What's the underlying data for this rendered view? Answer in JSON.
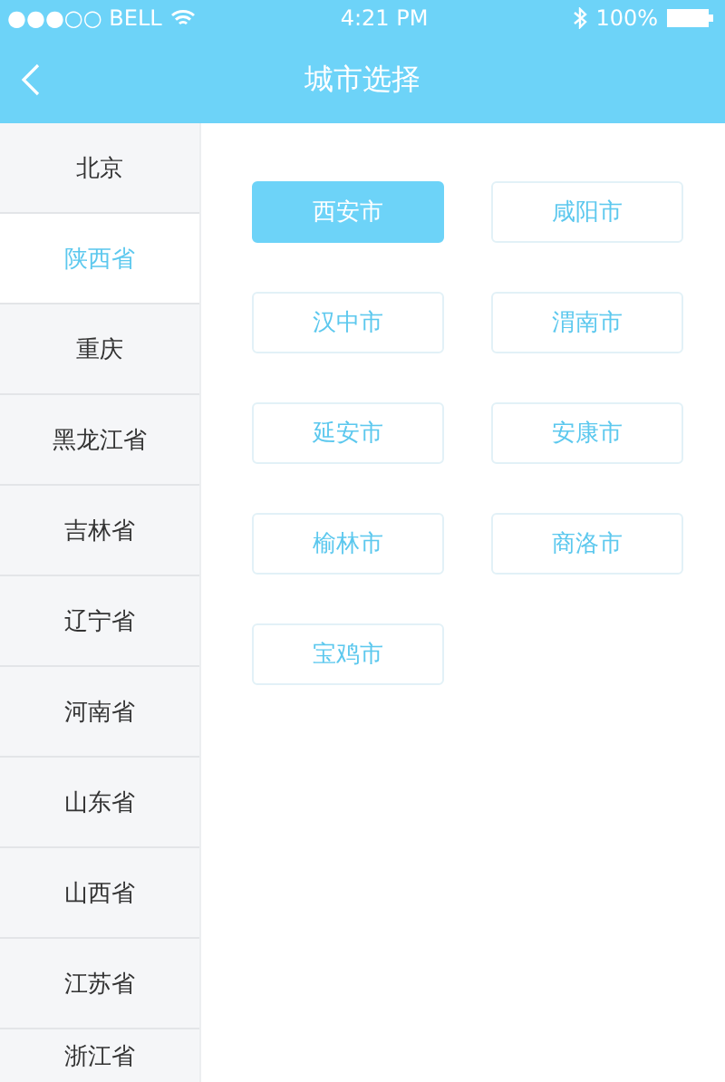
{
  "status_bar": {
    "carrier": "●●●○○ BELL",
    "time": "4:21 PM",
    "battery": "100%"
  },
  "nav_bar": {
    "title": "城市选择"
  },
  "provinces": [
    {
      "label": "北京",
      "selected": false
    },
    {
      "label": "陕西省",
      "selected": true
    },
    {
      "label": "重庆",
      "selected": false
    },
    {
      "label": "黑龙江省",
      "selected": false
    },
    {
      "label": "吉林省",
      "selected": false
    },
    {
      "label": "辽宁省",
      "selected": false
    },
    {
      "label": "河南省",
      "selected": false
    },
    {
      "label": "山东省",
      "selected": false
    },
    {
      "label": "山西省",
      "selected": false
    },
    {
      "label": "江苏省",
      "selected": false
    },
    {
      "label": "浙江省",
      "selected": false
    }
  ],
  "cities": [
    {
      "label": "西安市",
      "selected": true
    },
    {
      "label": "咸阳市",
      "selected": false
    },
    {
      "label": "汉中市",
      "selected": false
    },
    {
      "label": "渭南市",
      "selected": false
    },
    {
      "label": "延安市",
      "selected": false
    },
    {
      "label": "安康市",
      "selected": false
    },
    {
      "label": "榆林市",
      "selected": false
    },
    {
      "label": "商洛市",
      "selected": false
    },
    {
      "label": "宝鸡市",
      "selected": false
    }
  ]
}
